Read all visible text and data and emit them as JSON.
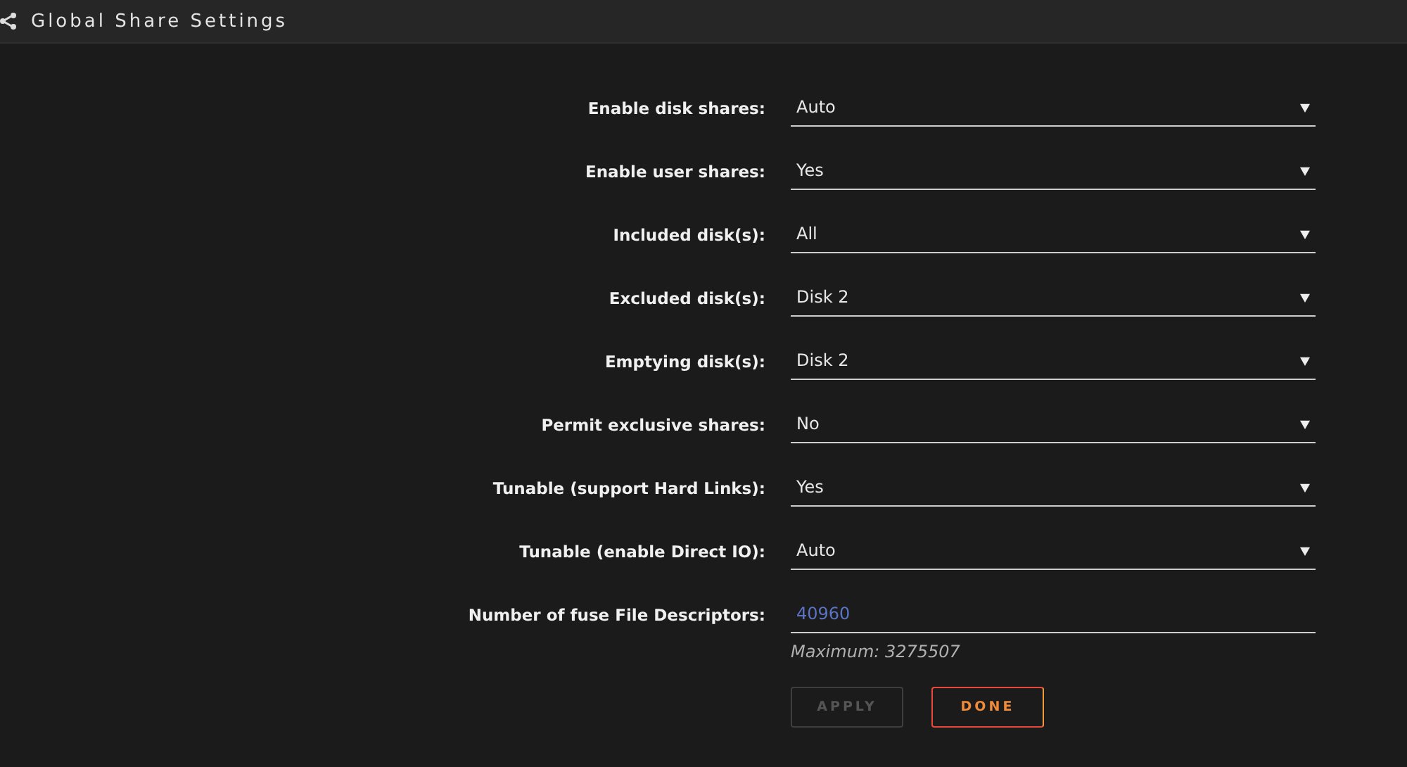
{
  "header": {
    "title": "Global Share Settings"
  },
  "fields": [
    {
      "kind": "select",
      "label": "Enable disk shares:",
      "value": "Auto"
    },
    {
      "kind": "select",
      "label": "Enable user shares:",
      "value": "Yes"
    },
    {
      "kind": "select",
      "label": "Included disk(s):",
      "value": "All"
    },
    {
      "kind": "select",
      "label": "Excluded disk(s):",
      "value": "Disk 2"
    },
    {
      "kind": "select",
      "label": "Emptying disk(s):",
      "value": "Disk 2"
    },
    {
      "kind": "select",
      "label": "Permit exclusive shares:",
      "value": "No"
    },
    {
      "kind": "select",
      "label": "Tunable (support Hard Links):",
      "value": "Yes"
    },
    {
      "kind": "select",
      "label": "Tunable (enable Direct IO):",
      "value": "Auto"
    },
    {
      "kind": "number",
      "label": "Number of fuse File Descriptors:",
      "value": "40960",
      "hint": "Maximum: 3275507"
    }
  ],
  "buttons": [
    {
      "label": "APPLY",
      "disabled": true
    },
    {
      "label": "DONE",
      "disabled": false
    }
  ]
}
